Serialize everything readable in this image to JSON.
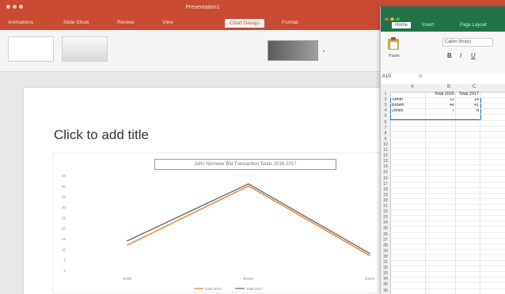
{
  "ppt": {
    "title": "Presentation1",
    "tabs": [
      "Animations",
      "Slide Show",
      "Review",
      "View",
      "Chart Design",
      "Format"
    ],
    "active_tab_index": 4,
    "slide_placeholder": "Click to add title",
    "chart_title": "John Nicmeier Bid Transaction Totals 2016-2017"
  },
  "chart_data": {
    "type": "line",
    "title": "John Nicmeier Bid Transaction Totals 2016-2017",
    "categories": [
      "Smith",
      "Brown",
      "Jones"
    ],
    "series": [
      {
        "name": "Total 2016",
        "values": [
          12,
          40,
          7
        ],
        "color": "#ed7d31"
      },
      {
        "name": "Total 2017",
        "values": [
          14,
          41,
          8
        ],
        "color": "#6b6b6b"
      }
    ],
    "ylim": [
      0,
      45
    ],
    "yticks": [
      "45",
      "40",
      "35",
      "30",
      "25",
      "20",
      "15",
      "10",
      "5",
      "0"
    ],
    "legend_position": "bottom"
  },
  "excel": {
    "tabs": [
      "Home",
      "Insert",
      "Page Layout"
    ],
    "active_tab_index": 0,
    "paste_label": "Paste",
    "font_name": "Calibri (Body)",
    "name_box": "A10",
    "formula_icon": "fx",
    "columns": [
      "A",
      "B",
      "C"
    ],
    "rows": [
      [
        "",
        "Total 2016",
        "Total 2017"
      ],
      [
        "Smith",
        "12",
        "14"
      ],
      [
        "Brown",
        "40",
        "41"
      ],
      [
        "Jones",
        "7",
        "8"
      ]
    ],
    "row_numbers": [
      "1",
      "2",
      "3",
      "4",
      "5",
      "6",
      "7",
      "8",
      "9",
      "10",
      "11",
      "12",
      "13",
      "14",
      "15",
      "16",
      "17",
      "18",
      "19",
      "20",
      "21",
      "22",
      "23",
      "24",
      "25",
      "26",
      "27",
      "28",
      "29",
      "30",
      "31",
      "32",
      "33",
      "34",
      "35",
      "36"
    ]
  },
  "colors": {
    "ppt_accent": "#c84b32",
    "excel_accent": "#217346"
  },
  "icons": {
    "paste": "clipboard-icon",
    "bold": "bold-icon",
    "italic": "italic-icon",
    "underline": "underline-icon"
  }
}
